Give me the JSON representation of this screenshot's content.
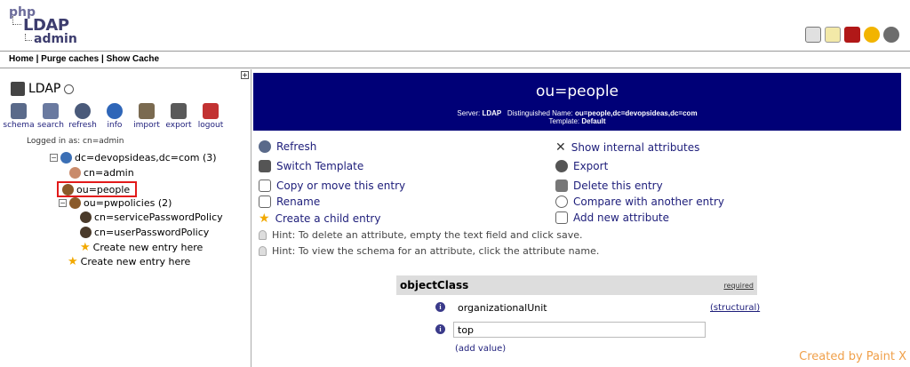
{
  "header": {
    "logo": {
      "line1": "php",
      "line2": "LDAP",
      "line3": "admin"
    },
    "top_icons": [
      "help-icon",
      "bulb-icon",
      "bug-icon",
      "smiley-icon",
      "question-icon"
    ]
  },
  "menu": {
    "home": "Home",
    "sep1": " | ",
    "purge": "Purge caches",
    "sep2": " | ",
    "cache": "Show Cache"
  },
  "tree": {
    "expand": "+",
    "server_name": "LDAP",
    "tools": [
      {
        "label": "schema",
        "icon": "schema-icon"
      },
      {
        "label": "search",
        "icon": "search-icon"
      },
      {
        "label": "refresh",
        "icon": "refresh-icon"
      },
      {
        "label": "info",
        "icon": "info-icon"
      },
      {
        "label": "import",
        "icon": "import-icon"
      },
      {
        "label": "export",
        "icon": "export-icon"
      },
      {
        "label": "logout",
        "icon": "logout-icon"
      }
    ],
    "logged_in": "Logged in as: cn=admin",
    "root": "dc=devopsideas,dc=com (3)",
    "admin": "cn=admin",
    "people": "ou=people",
    "pwpolicies": "ou=pwpolicies (2)",
    "service_policy": "cn=servicePasswordPolicy",
    "user_policy": "cn=userPasswordPolicy",
    "create_inner": "Create new entry here",
    "create_outer": "Create new entry here"
  },
  "entry": {
    "title": "ou=people",
    "server_label": "Server:",
    "server_value": "LDAP",
    "dn_label": "Distinguished Name:",
    "dn_value": "ou=people,dc=devopsideas,dc=com",
    "template_label": "Template:",
    "template_value": "Default"
  },
  "actions": {
    "refresh": "Refresh",
    "switch_template": "Switch Template",
    "copy_move": "Copy or move this entry",
    "rename": "Rename",
    "create_child": "Create a child entry",
    "show_internal": "Show internal attributes",
    "export": "Export",
    "delete": "Delete this entry",
    "compare": "Compare with another entry",
    "add_attribute": "Add new attribute"
  },
  "hints": {
    "hint1": "Hint: To delete an attribute, empty the text field and click save.",
    "hint2": "Hint: To view the schema for an attribute, click the attribute name."
  },
  "attribute": {
    "name": "objectClass",
    "required": "required",
    "value1": "organizationalUnit",
    "value1_kind": "(structural)",
    "value2": "top",
    "add_value": "(add value)"
  },
  "watermark": "Created by Paint X",
  "colors": {
    "title_bar": "#000077",
    "link": "#1d1d7a",
    "selection_border": "#e21a1a"
  }
}
